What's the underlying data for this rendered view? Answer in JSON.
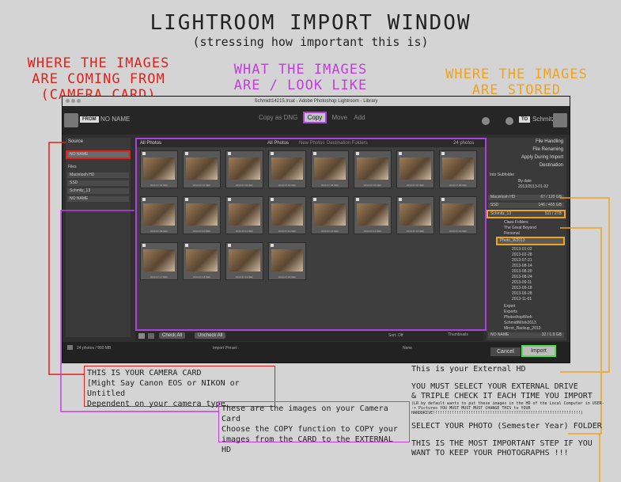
{
  "header": {
    "title": "LIGHTROOM IMPORT WINDOW",
    "subtitle": "(stressing how important this is)"
  },
  "headings": {
    "left": [
      "WHERE THE IMAGES",
      "ARE COMING FROM",
      "(CAMERA CARD)"
    ],
    "middle": [
      "WHAT THE IMAGES",
      "ARE / LOOK LIKE"
    ],
    "right": [
      "WHERE THE IMAGES",
      "ARE STORED"
    ]
  },
  "window": {
    "title": "Schmidt14215.lrcat - Adobe Photoshop Lightroom - Library",
    "from_badge": "FROM",
    "from_name": "NO NAME",
    "to_badge": "TO",
    "to_name": "Schmitz_13",
    "modes": [
      "Copy as DNG",
      "Copy",
      "Move",
      "Add"
    ],
    "selected_mode": "Copy",
    "left_panel": {
      "header": "Source",
      "selected_device": "NO NAME",
      "files_header": "Files",
      "drives": [
        "Macintosh HD",
        "SSD",
        "Schmitz_13",
        "NO NAME"
      ]
    },
    "grid": {
      "header": "All Photos",
      "view_tabs": [
        "All Photos",
        "New Photos",
        "Destination Folders"
      ],
      "count": "24 photos",
      "captions": [
        "2013-07-01.NEF",
        "2013-07-02.NEF",
        "2013-07-03.NEF",
        "2013-07-04.NEF",
        "2013-07-05.NEF",
        "2013-07-06.NEF",
        "2013-07-07.NEF",
        "2013-07-08.NEF",
        "2013-07-09.NEF",
        "2013-07-10.NEF",
        "2013-07-11.NEF",
        "2013-07-12.NEF",
        "2013-07-13.NEF",
        "2013-07-14.NEF",
        "2013-07-15.NEF",
        "2013-07-16.NEF",
        "2013-07-17.NEF",
        "2013-07-18.NEF",
        "2013-07-19.NEF",
        "2013-07-20.NEF"
      ]
    },
    "bottombar": {
      "check_all": "Check All",
      "uncheck_all": "Uncheck All",
      "sort_label": "Sort: Off",
      "thumbnails_label": "Thumbnails"
    },
    "right_panel": {
      "sections": [
        "File Handling",
        "File Renaming",
        "Apply During Import",
        "Destination"
      ],
      "into_subfolder": "Into Subfolder",
      "organize": "By date",
      "date_format": "2013/2013-01-02",
      "drives": [
        "Macintosh HD",
        "SSD",
        "Schmitz_13"
      ],
      "drive_sizes": [
        "67 / 120 GB",
        "146 / 465 GB",
        "511 / 2TB"
      ],
      "folders": [
        "Class Folders",
        "The Great Beyond",
        "Personal",
        "Photo_W2013"
      ],
      "date_folders": [
        "2013-01-02",
        "2013-02-28",
        "2013-07-21",
        "2013-08-14",
        "2013-08-20",
        "2013-08-24",
        "2013-09-11",
        "2013-09-18",
        "2013-09-28",
        "2013-11-01"
      ],
      "extra_folders": [
        "Export",
        "Exports",
        "PhotoshopWork",
        "SchmidtWork2013",
        "Mirror_Backup_2013"
      ],
      "no_name": "NO NAME",
      "no_name_size": "32 / 1.9 GB"
    },
    "footer": {
      "info": "24 photos / 990 MB",
      "preset_label": "Import Preset :",
      "preset_value": "None",
      "cancel": "Cancel",
      "import": "Import"
    }
  },
  "annotations": {
    "card": [
      "THIS IS YOUR CAMERA CARD",
      "[Might Say Canon EOS or NIKON or Untitled",
      "Dependent on your camera type"
    ],
    "photos": [
      "These are the images on your Camera Card",
      "Choose the COPY function to COPY your",
      "images from the CARD to the EXTERNAL HD"
    ],
    "external": {
      "line1": "This is your External HD",
      "line2": "YOU MUST SELECT YOUR EXTERNAL DRIVE",
      "line3": "& TRIPLE CHECK IT EACH TIME YOU IMPORT",
      "line4": "(LR by default wants to put these images in the HD of the Local Computer in USER--> Pictures YOU MUST MUST MUST CHANGE THIS to YOUR HARDDRIVE!!!!!!!!!!!!!!!!!!!!!!!!!!!!!!!!!!!!!!!!!!!!!!!!!!!!!!!!!!!!!!)",
      "line5": "SELECT YOUR PHOTO (Semester Year) FOLDER",
      "line6": "THIS IS THE MOST IMPORTANT STEP IF YOU",
      "line7": "WANT TO KEEP YOUR PHOTOGRAPHS !!!"
    }
  },
  "colors": {
    "red": "#e0221c",
    "purple": "#c43ce0",
    "orange": "#f2a21c",
    "green": "#4ce04c"
  }
}
